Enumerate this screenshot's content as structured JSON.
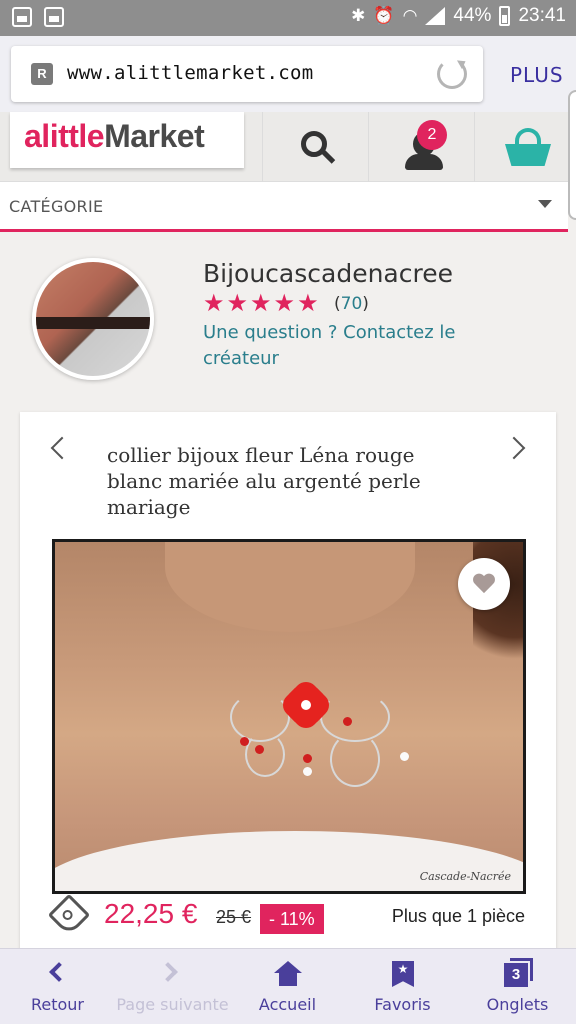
{
  "status_bar": {
    "battery": "44%",
    "time": "23:41"
  },
  "browser": {
    "url": "www.alittlemarket.com",
    "menu_label": "PLUS"
  },
  "site": {
    "logo_part1": "alittle",
    "logo_part2": "Market",
    "cart_badge": "2",
    "category_label": "CATÉGORIE",
    "brand_color": "#e0245e",
    "accent_color": "#2bb3a7"
  },
  "seller": {
    "name": "Bijoucascadenacree",
    "rating_stars": 5,
    "rating_count": "70",
    "contact_text": "Une question ? Contactez le créateur"
  },
  "product": {
    "title": "collier bijoux fleur Léna rouge blanc mariée alu argenté perle mariage",
    "image_watermark": "Cascade-Nacrée",
    "price": "22,25 €",
    "old_price": "25 €",
    "discount": "- 11%",
    "stock": "Plus que 1 pièce"
  },
  "bottom_nav": {
    "back": "Retour",
    "next": "Page suivante",
    "home": "Accueil",
    "favorites": "Favoris",
    "tabs": "Onglets",
    "tabs_count": "3"
  }
}
